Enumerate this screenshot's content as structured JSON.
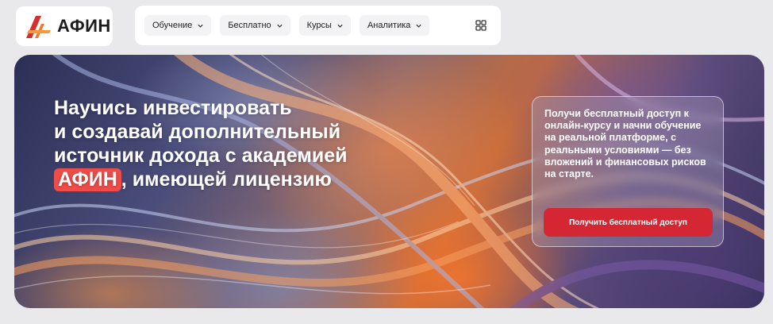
{
  "logo": {
    "text": "АФИН"
  },
  "nav": {
    "items": [
      {
        "label": "Обучение"
      },
      {
        "label": "Бесплатно"
      },
      {
        "label": "Курсы"
      },
      {
        "label": "Аналитика"
      }
    ],
    "menu_icon": "grid-icon"
  },
  "hero": {
    "headline": {
      "line1": "Научись инвестировать",
      "line2": "и создавай дополнительный",
      "line3": "источник дохода с академией",
      "brand": "АФИН",
      "line4_rest": ", имеющей лицензию"
    },
    "offer": {
      "text": "Получи бесплатный доступ к онлайн-курсу и начни обучение на реальной платформе, с реальными условиями — без вложений и финансовых рисков на старте.",
      "button_label": "Получить бесплатный доступ"
    }
  },
  "colors": {
    "accent_red": "#d52733",
    "brand_chip": "#ef4d4a",
    "logo_orange": "#f07a2a"
  }
}
